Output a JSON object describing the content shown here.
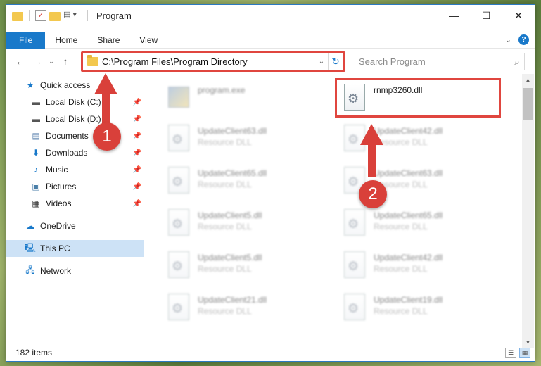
{
  "window": {
    "title": "Program",
    "controls": {
      "minimize": "—",
      "maximize": "☐",
      "close": "✕"
    }
  },
  "ribbon": {
    "tabs": [
      "File",
      "Home",
      "Share",
      "View"
    ],
    "help": "?"
  },
  "address_bar": {
    "path": "C:\\Program Files\\Program Directory"
  },
  "search": {
    "placeholder": "Search Program"
  },
  "sidebar": {
    "quick_access": "Quick access",
    "pinned": [
      {
        "label": "Local Disk (C:)",
        "icon": "drive-icon"
      },
      {
        "label": "Local Disk (D:)",
        "icon": "drive-icon"
      },
      {
        "label": "Documents",
        "icon": "documents-icon"
      },
      {
        "label": "Downloads",
        "icon": "downloads-icon"
      },
      {
        "label": "Music",
        "icon": "music-icon"
      },
      {
        "label": "Pictures",
        "icon": "pictures-icon"
      },
      {
        "label": "Videos",
        "icon": "videos-icon"
      }
    ],
    "onedrive": "OneDrive",
    "this_pc": "This PC",
    "network": "Network"
  },
  "files": {
    "program": {
      "name": "program.exe"
    },
    "target": {
      "name": "rnmp3260.dll"
    },
    "left_column": [
      {
        "name": "UpdateClient63.dll",
        "type": "Resource DLL"
      },
      {
        "name": "UpdateClient65.dll",
        "type": "Resource DLL"
      },
      {
        "name": "UpdateClient5.dll",
        "type": "Resource DLL"
      },
      {
        "name": "UpdateClient5.dll",
        "type": "Resource DLL"
      },
      {
        "name": "UpdateClient21.dll",
        "type": "Resource DLL"
      }
    ],
    "right_column": [
      {
        "name": "UpdateClient42.dll",
        "type": "Resource DLL"
      },
      {
        "name": "UpdateClient63.dll",
        "type": "Resource DLL"
      },
      {
        "name": "UpdateClient65.dll",
        "type": "Resource DLL"
      },
      {
        "name": "UpdateClient42.dll",
        "type": "Resource DLL"
      },
      {
        "name": "UpdateClient19.dll",
        "type": "Resource DLL"
      }
    ]
  },
  "status": {
    "item_count": "182 items"
  },
  "callouts": {
    "one": "1",
    "two": "2"
  },
  "colors": {
    "accent": "#1979ca",
    "highlight": "#e0463f",
    "selected": "#cde2f6"
  }
}
